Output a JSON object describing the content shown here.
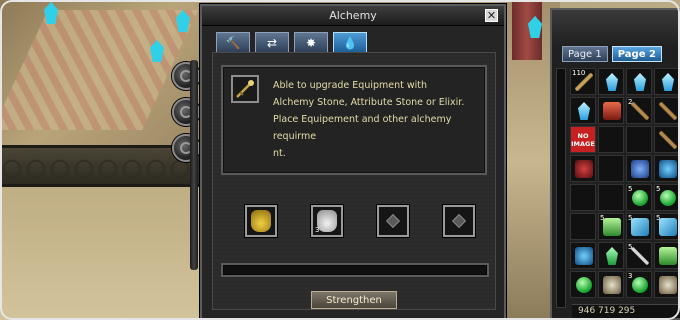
{
  "alchemy_window": {
    "title": "Alchemy",
    "close_glyph": "✕",
    "tabs": [
      {
        "icon": "hammer-icon",
        "glyph": "🔨",
        "active": false
      },
      {
        "icon": "refresh-arrows-icon",
        "glyph": "⇄",
        "active": false
      },
      {
        "icon": "sparkle-icon",
        "glyph": "✸",
        "active": false
      },
      {
        "icon": "water-drop-icon",
        "glyph": "💧",
        "active": true
      }
    ],
    "info": {
      "icon": "wand-icon",
      "lines": [
        "Able to upgrade Equipment with",
        "Alchemy Stone, Attribute Stone or Elixir.",
        "Place Equipement and other alchemy requirme",
        "nt."
      ]
    },
    "slots": [
      {
        "item": "gold-elixir-bag-icon",
        "count": ""
      },
      {
        "item": "white-elixir-bag-icon",
        "count": "3"
      },
      {
        "item": "empty-slot-icon",
        "count": ""
      },
      {
        "item": "empty-slot-icon",
        "count": ""
      }
    ],
    "progress": 0.0,
    "strengthen_label": "Strengthen"
  },
  "inventory": {
    "tabs": [
      {
        "label": "Page 1",
        "active": false
      },
      {
        "label": "Page 2",
        "active": true
      }
    ],
    "items": [
      {
        "icon": "bow-icon",
        "count": "110"
      },
      {
        "icon": "blue-crystal-icon",
        "count": ""
      },
      {
        "icon": "blue-crystal-icon",
        "count": ""
      },
      {
        "icon": "blue-crystal-icon",
        "count": ""
      },
      {
        "icon": "blue-crystal-icon",
        "count": ""
      },
      {
        "icon": "red-potion-icon",
        "count": ""
      },
      {
        "icon": "crossbow-icon",
        "count": "2"
      },
      {
        "icon": "crossbow-icon",
        "count": ""
      },
      {
        "icon": "no-image-icon",
        "count": "",
        "text": "NO IMAGE"
      },
      {
        "icon": "empty",
        "count": ""
      },
      {
        "icon": "empty",
        "count": ""
      },
      {
        "icon": "crossbow-icon",
        "count": ""
      },
      {
        "icon": "red-pouch-icon",
        "count": ""
      },
      {
        "icon": "empty",
        "count": ""
      },
      {
        "icon": "blue-pouch-icon",
        "count": ""
      },
      {
        "icon": "blue-creature-icon",
        "count": ""
      },
      {
        "icon": "empty",
        "count": ""
      },
      {
        "icon": "empty",
        "count": ""
      },
      {
        "icon": "green-orb-icon",
        "count": "5"
      },
      {
        "icon": "green-orb-icon",
        "count": "5"
      },
      {
        "icon": "empty",
        "count": ""
      },
      {
        "icon": "green-bottle-icon",
        "count": "5"
      },
      {
        "icon": "blue-box-icon",
        "count": "5"
      },
      {
        "icon": "blue-box-icon",
        "count": "5"
      },
      {
        "icon": "blue-creature-icon",
        "count": ""
      },
      {
        "icon": "green-gem-icon",
        "count": ""
      },
      {
        "icon": "sword-icon",
        "count": "5"
      },
      {
        "icon": "green-bottle-icon",
        "count": ""
      },
      {
        "icon": "green-orb-icon",
        "count": ""
      },
      {
        "icon": "skeleton-icon",
        "count": ""
      },
      {
        "icon": "green-orb-icon",
        "count": "3"
      },
      {
        "icon": "skeleton-icon",
        "count": ""
      }
    ],
    "gold_text": "946 719 295"
  },
  "colors": {
    "info_text": "#e3dca8",
    "tab_active": "#4d9bd6",
    "crystal": "#33c6f0",
    "green_orb": "#2fd44a"
  }
}
